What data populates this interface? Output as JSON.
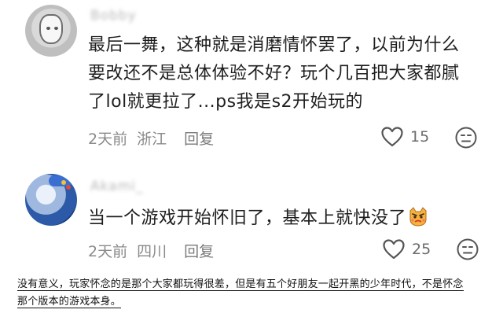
{
  "comments": [
    {
      "username": "Bobby",
      "text_lines": [
        "最后一舞，这种就是消磨情怀罢了，以前为什么",
        "要改还不是总体体验不好？玩个几百把大家都腻",
        "了lol就更拉了...ps我是s2开始玩的"
      ],
      "time": "2天前",
      "location": "浙江",
      "reply_label": "回复",
      "like_count": "15"
    },
    {
      "username": "Akami_",
      "text": "当一个游戏开始怀旧了，基本上就快没了",
      "time": "2天前",
      "location": "四川",
      "reply_label": "回复",
      "like_count": "25"
    }
  ],
  "bottom_text": {
    "line1": "没有意义，玩家怀念的是那个大家都玩得很差，但是有五个好朋友一起开黑的少年时代，不是怀念",
    "line2": "那个版本的游戏本身。"
  }
}
